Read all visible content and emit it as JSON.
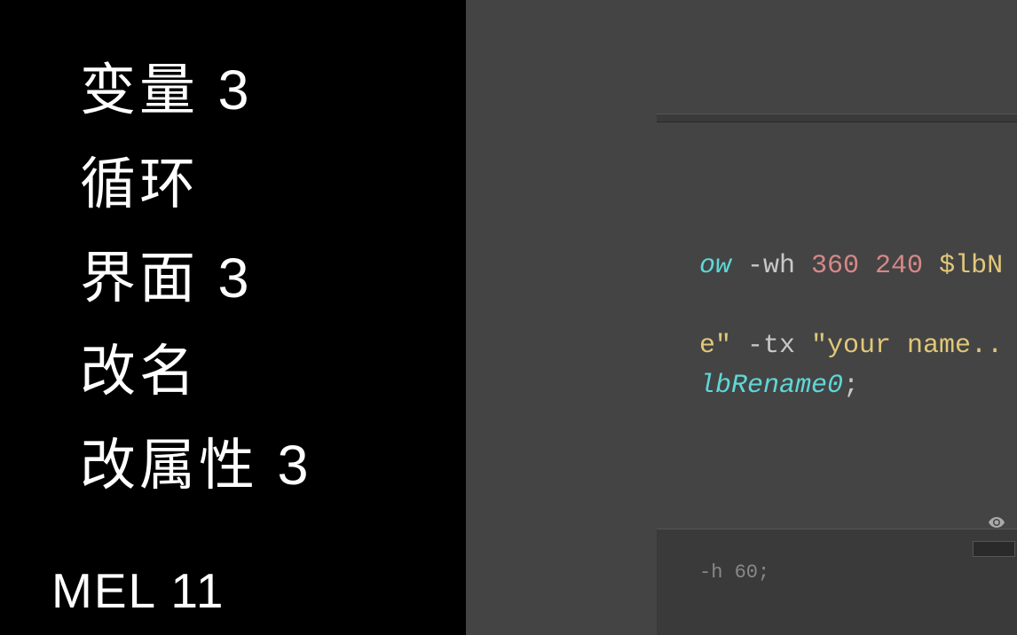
{
  "topics": {
    "item1": "变量 3",
    "item2": "循环",
    "item3": "界面 3",
    "item4": "改名",
    "item5": "改属性 3"
  },
  "footer": "MEL 11",
  "code": {
    "line1_cmd": "ow",
    "line1_flag": " -wh ",
    "line1_num": "360 240",
    "line1_var": " $lbN",
    "line2_a": "e\"",
    "line2_flag": " -tx ",
    "line2_str": "\"your name..",
    "line3_ident": "lbRename0",
    "line3_semi": ";"
  },
  "bottom": {
    "snippet": "-h 60;"
  }
}
